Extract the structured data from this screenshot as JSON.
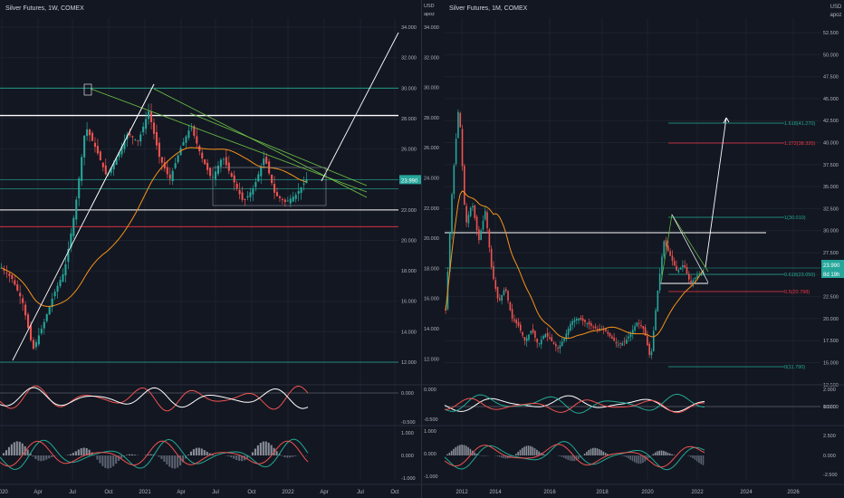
{
  "left_chart": {
    "title": "Silver Futures, 1W, COMEX",
    "price_ticks": [
      "34.000",
      "32.000",
      "30.000",
      "28.000",
      "26.000",
      "24.000",
      "22.000",
      "20.000",
      "18.000",
      "16.000",
      "14.000",
      "12.000"
    ],
    "price_values": [
      34,
      32,
      30,
      28,
      26,
      24,
      22,
      20,
      18,
      16,
      14,
      12
    ],
    "current_price": "23.990",
    "osc1_ticks": [
      "0.000",
      "-0.500"
    ],
    "osc2_ticks": [
      "1.000",
      "0.000",
      "-1.000"
    ],
    "time_ticks": [
      "2020",
      "Apr",
      "Jul",
      "Oct",
      "2021",
      "Apr",
      "Jul",
      "Oct",
      "2022",
      "Apr",
      "Jul",
      "Oct"
    ]
  },
  "right_chart": {
    "title": "Silver Futures, 1M, COMEX",
    "currency": "USD",
    "scale_label": "apoz",
    "price_ticks": [
      "52.500",
      "50.000",
      "47.500",
      "45.000",
      "42.500",
      "40.000",
      "37.500",
      "35.000",
      "32.500",
      "30.000",
      "27.500",
      "25.000",
      "22.500",
      "20.000",
      "17.500",
      "15.000",
      "12.500",
      "10.000"
    ],
    "current_price": "23.990",
    "current_price_sub": "8d 19h",
    "left_scale_ticks": [
      "USD",
      "apoz",
      "34.000",
      "32.000",
      "30.000",
      "28.000",
      "26.000",
      "24.000",
      "22.000",
      "20.000",
      "18.000",
      "16.000",
      "14.000",
      "12.000"
    ],
    "fib_labels": [
      "1.618(41.270)",
      "1.272(38.320)",
      "1(30.010)",
      "0.618(23.050)",
      "0.5(20.798)",
      "0(11.790)"
    ],
    "osc1_ticks": [
      "2.000",
      "0.000"
    ],
    "osc2_ticks": [
      "2.500",
      "0.000",
      "-2.500"
    ],
    "left_osc1_ticks": [
      "0.000",
      "-0.500"
    ],
    "left_osc2_ticks": [
      "1.000",
      "0.000",
      "-1.000"
    ],
    "time_ticks": [
      "2012",
      "2014",
      "2016",
      "2018",
      "2020",
      "2022",
      "2024",
      "2026"
    ]
  },
  "colors": {
    "background": "#131722",
    "bull": "#26a69a",
    "bear": "#ef5350",
    "ma": "#f7931a",
    "trend_green": "#6ec445",
    "level_white": "#ffffff",
    "level_teal": "#22ab94",
    "level_red": "#f23645",
    "price_tag": "#26a69a"
  },
  "chart_data": [
    {
      "type": "candlestick",
      "title": "Silver Futures, 1W, COMEX",
      "x": [
        "2020",
        "Apr",
        "Jul",
        "Oct",
        "2021",
        "Apr",
        "Jul",
        "Oct",
        "2022",
        "Apr",
        "Jul",
        "Oct"
      ],
      "ylim": [
        11.5,
        35
      ],
      "series": [
        {
          "values": [
            18.0,
            14.5,
            12.5,
            16.0,
            19.5,
            25.0,
            28.5,
            24.0,
            27.0,
            26.5,
            24.0,
            28.0,
            25.5,
            24.5,
            22.0,
            24.0,
            25.5,
            23.0,
            22.5,
            23.99
          ]
        }
      ],
      "levels": [
        30.0,
        28.2,
        22.0,
        20.9,
        12.0
      ],
      "grid": true
    },
    {
      "type": "candlestick",
      "title": "Silver Futures, 1M, COMEX",
      "x": [
        "2012",
        "2014",
        "2016",
        "2018",
        "2020",
        "2022",
        "2024",
        "2026"
      ],
      "ylim": [
        10,
        54
      ],
      "series": [
        {
          "values": [
            30.0,
            42.0,
            33.0,
            31.0,
            28.0,
            22.0,
            19.0,
            16.0,
            15.0,
            14.0,
            17.0,
            16.5,
            15.0,
            14.0,
            16.5,
            17.0,
            12.0,
            20.0,
            28.0,
            26.0,
            23.0,
            23.99
          ]
        }
      ],
      "levels": [
        41.27,
        38.32,
        30.01,
        23.05,
        20.798,
        11.79
      ],
      "grid": true
    }
  ]
}
